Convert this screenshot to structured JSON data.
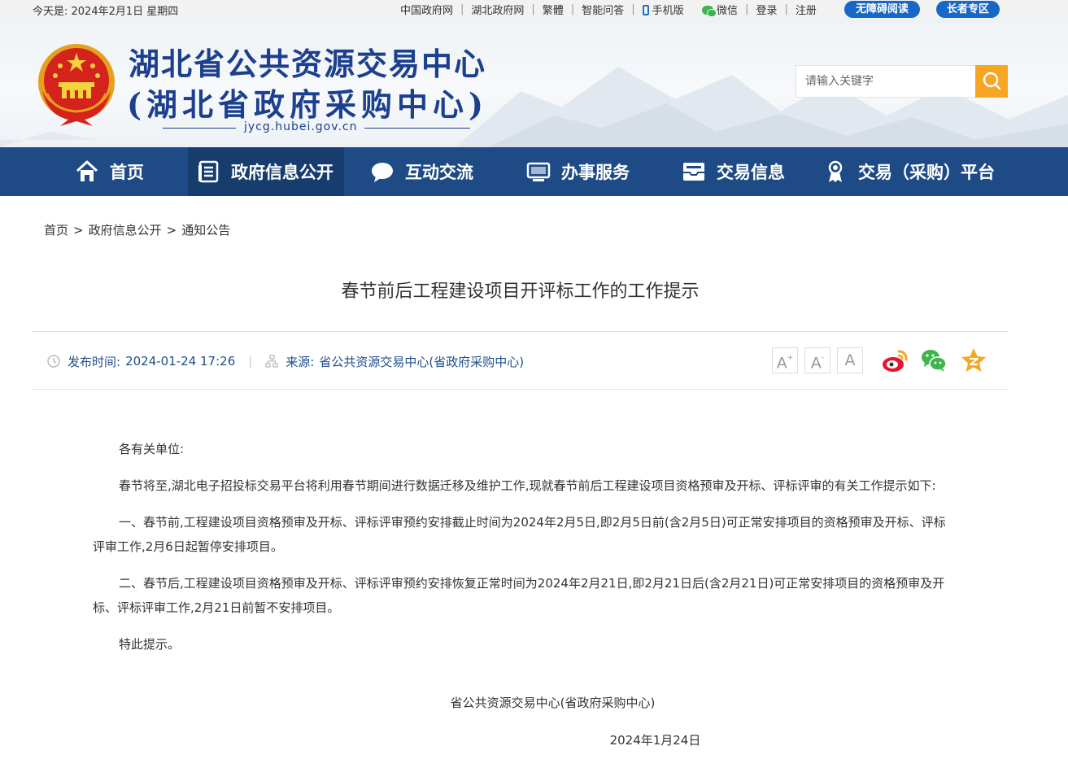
{
  "topbar": {
    "date_text": "今天是: 2024年2月1日 星期四",
    "links": [
      "中国政府网",
      "湖北政府网",
      "繁體",
      "智能问答",
      "手机版",
      "微信",
      "登录",
      "注册"
    ],
    "accessibility_label": "无障碍阅读",
    "elder_label": "长者专区"
  },
  "header": {
    "title_line1": "湖北省公共资源交易中心",
    "title_line2": "(湖北省政府采购中心)",
    "domain": "jycg.hubei.gov.cn",
    "search_placeholder": "请输入关键字"
  },
  "nav": {
    "items": [
      {
        "label": "首页",
        "icon": "home-icon"
      },
      {
        "label": "政府信息公开",
        "icon": "document-list-icon"
      },
      {
        "label": "互动交流",
        "icon": "chat-bubble-icon"
      },
      {
        "label": "办事服务",
        "icon": "monitor-icon"
      },
      {
        "label": "交易信息",
        "icon": "inbox-icon"
      },
      {
        "label": "交易（采购）平台",
        "icon": "award-person-icon"
      }
    ],
    "active_index": 1
  },
  "breadcrumb": [
    "首页",
    "政府信息公开",
    "通知公告"
  ],
  "article": {
    "title": "春节前后工程建设项目开评标工作的工作提示",
    "publish_label": "发布时间:",
    "publish_time": "2024-01-24 17:26",
    "source_label": "来源:",
    "source": "省公共资源交易中心(省政府采购中心)",
    "font_buttons": [
      "A+",
      "A-",
      "A"
    ],
    "share_icons": [
      "weibo-icon",
      "wechat-icon",
      "qzone-icon"
    ],
    "paragraphs": [
      "各有关单位:",
      "春节将至,湖北电子招投标交易平台将利用春节期间进行数据迁移及维护工作,现就春节前后工程建设项目资格预审及开标、评标评审的有关工作提示如下:",
      "一、春节前,工程建设项目资格预审及开标、评标评审预约安排截止时间为2024年2月5日,即2月5日前(含2月5日)可正常安排项目的资格预审及开标、评标评审工作,2月6日起暂停安排项目。",
      "二、春节后,工程建设项目资格预审及开标、评标评审预约安排恢复正常时间为2024年2月21日,即2月21日后(含2月21日)可正常安排项目的资格预审及开标、评标评审工作,2月21日前暂不安排项目。",
      "特此提示。"
    ],
    "signature": "省公共资源交易中心(省政府采购中心)",
    "sign_date": "2024年1月24日"
  },
  "colors": {
    "nav_bg": "#1e4b86",
    "nav_active": "#173c6e",
    "title_blue": "#1c3f8e",
    "search_button": "#f6a623",
    "pill_blue": "#1667c6"
  }
}
